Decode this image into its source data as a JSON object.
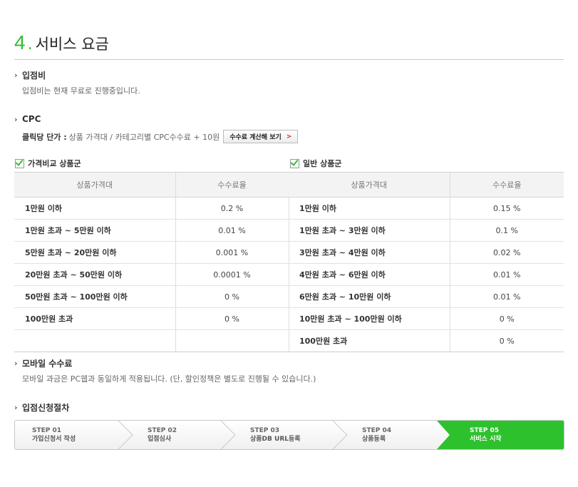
{
  "title": {
    "number": "4",
    "dot": ".",
    "text": "서비스 요금"
  },
  "entry_fee": {
    "heading": "입점비",
    "desc": "입점비는 현재  무료로 진행중입니다."
  },
  "cpc": {
    "heading": "CPC",
    "label": "클릭당 단가 :",
    "desc": "상품 가격대 / 카테고리별 CPC수수료 + 10원",
    "button": "수수료 계산해 보기",
    "button_arrow": ">"
  },
  "price_compare": {
    "label": "가격비교 상품군",
    "headers": [
      "상품가격대",
      "수수료율"
    ],
    "rows": [
      {
        "range": "1만원 이하",
        "rate": "0.2 %"
      },
      {
        "range": "1만원 초과 ~ 5만원 이하",
        "rate": "0.01 %"
      },
      {
        "range": "5만원 초과 ~ 20만원 이하",
        "rate": "0.001 %"
      },
      {
        "range": "20만원 초과 ~ 50만원 이하",
        "rate": "0.0001 %"
      },
      {
        "range": "50만원 초과 ~ 100만원 이하",
        "rate": "0 %"
      },
      {
        "range": "100만원 초과",
        "rate": "0 %"
      },
      {
        "range": "",
        "rate": ""
      }
    ]
  },
  "general": {
    "label": "일반 상품군",
    "headers": [
      "상품가격대",
      "수수료율"
    ],
    "rows": [
      {
        "range": "1만원 이하",
        "rate": "0.15 %"
      },
      {
        "range": "1만원 초과 ~ 3만원 이하",
        "rate": "0.1 %"
      },
      {
        "range": "3만원 초과 ~ 4만원 이하",
        "rate": "0.02 %"
      },
      {
        "range": "4만원 초과 ~ 6만원 이하",
        "rate": "0.01 %"
      },
      {
        "range": "6만원 초과 ~ 10만원 이하",
        "rate": "0.01 %"
      },
      {
        "range": "10만원 초과 ~ 100만원 이하",
        "rate": "0 %"
      },
      {
        "range": "100만원 초과",
        "rate": "0 %"
      }
    ]
  },
  "mobile": {
    "heading": "모바일 수수료",
    "desc": "모바일 과금은 PC웹과 동일하게 적용됩니다. (단, 할인정책은 별도로 진행될 수 있습니다.)"
  },
  "procedure": {
    "heading": "입점신청절차",
    "steps": [
      {
        "num": "STEP 01",
        "label": "가입신청서 작성"
      },
      {
        "num": "STEP 02",
        "label": "입점심사"
      },
      {
        "num": "STEP 03",
        "label": "상품DB URL등록"
      },
      {
        "num": "STEP 04",
        "label": "상품등록"
      },
      {
        "num": "STEP 05",
        "label": "서비스 시작"
      }
    ],
    "active_color": "#2ec12e"
  },
  "colors": {
    "accent": "#2fbf2f"
  }
}
